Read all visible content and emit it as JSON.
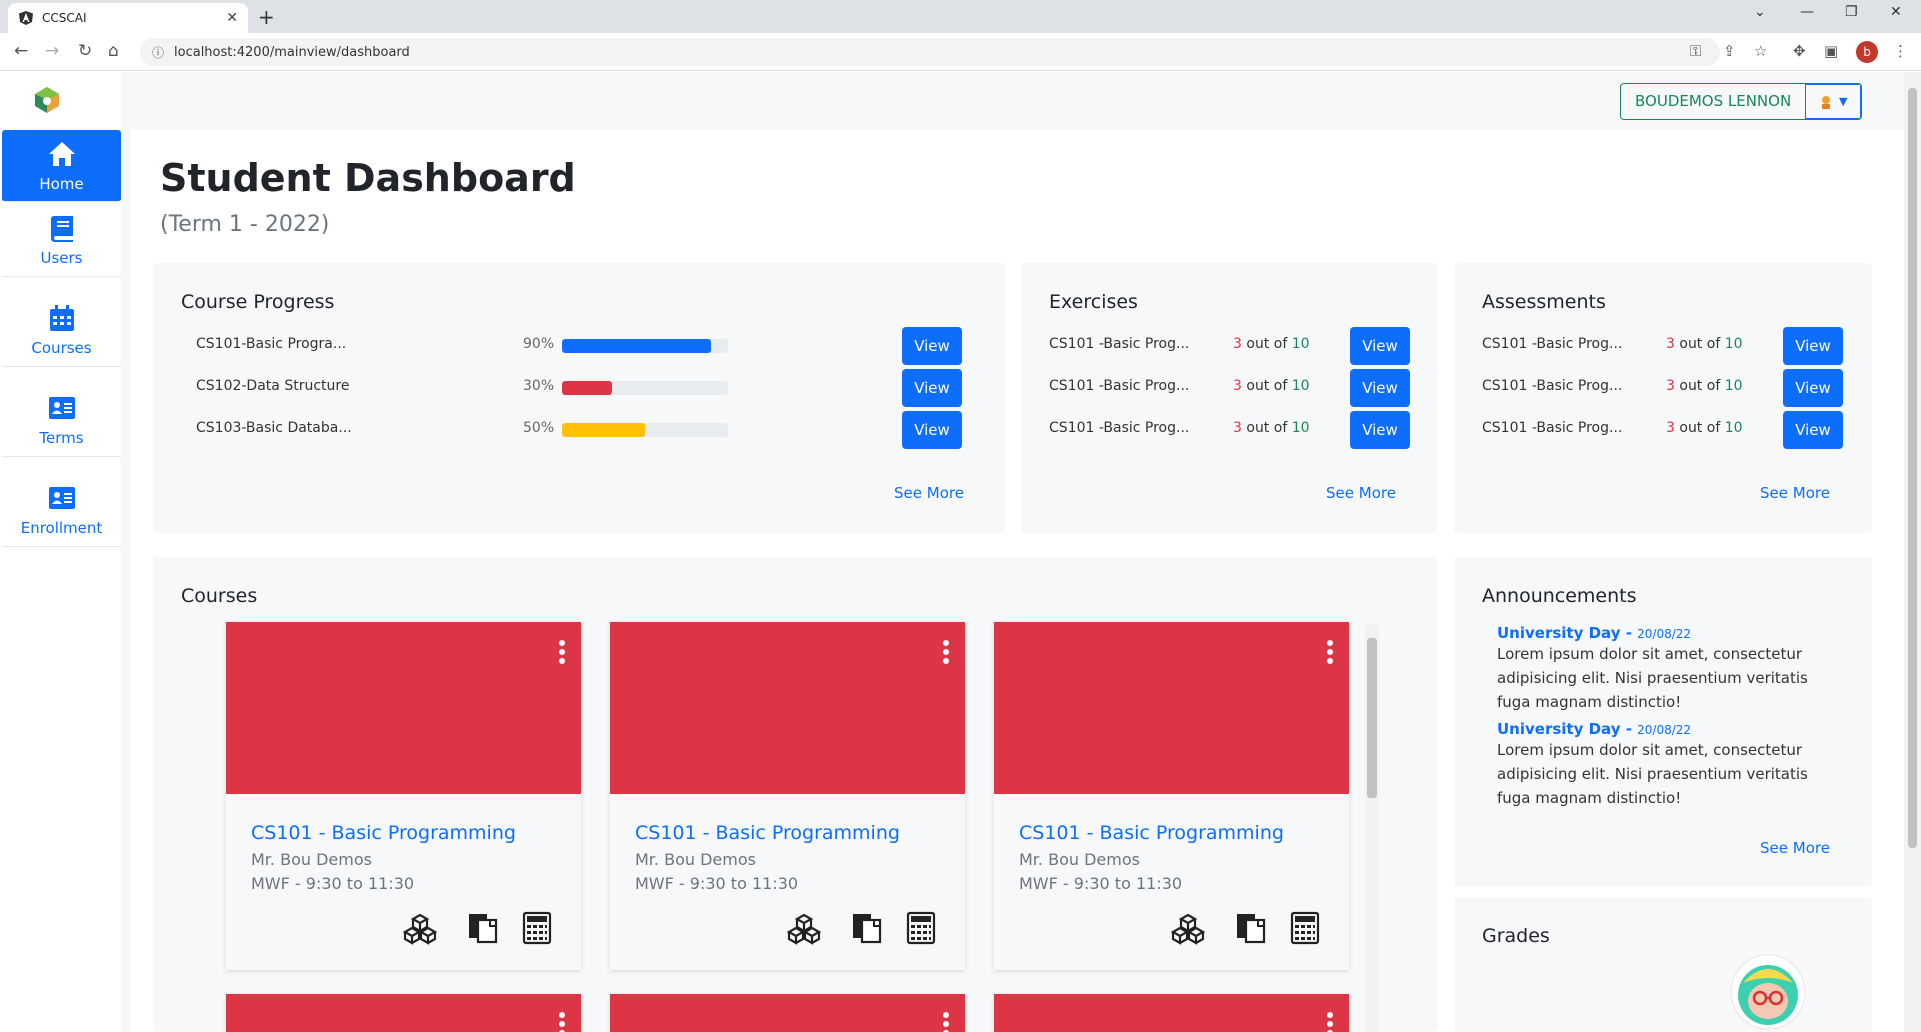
{
  "browser": {
    "tab_title": "CCSCAI",
    "url": "localhost:4200/mainview/dashboard",
    "profile_initial": "b"
  },
  "sidebar": {
    "items": [
      {
        "label": "Home",
        "icon": "home-icon",
        "active": true
      },
      {
        "label": "Users",
        "icon": "book-icon"
      },
      {
        "label": "Courses",
        "icon": "calendar-icon"
      },
      {
        "label": "Terms",
        "icon": "id-card-icon"
      },
      {
        "label": "Enrollment",
        "icon": "id-card-icon"
      }
    ]
  },
  "header": {
    "user_name": "BOUDEMOS LENNON"
  },
  "page": {
    "title": "Student Dashboard",
    "subtitle": "(Term 1 - 2022)"
  },
  "course_progress": {
    "title": "Course Progress",
    "rows": [
      {
        "name": "CS101-Basic Progra...",
        "pct": "90%",
        "value": 0.9,
        "color": "#0d6efd"
      },
      {
        "name": "CS102-Data Structure",
        "pct": "30%",
        "value": 0.3,
        "color": "#dc3545"
      },
      {
        "name": "CS103-Basic Databa...",
        "pct": "50%",
        "value": 0.5,
        "color": "#ffc107"
      }
    ],
    "view_label": "View",
    "see_more": "See More"
  },
  "exercises": {
    "title": "Exercises",
    "rows": [
      {
        "name": "CS101 -Basic Prog...",
        "done": "3",
        "mid": " out of ",
        "total": "10"
      },
      {
        "name": "CS101 -Basic Prog...",
        "done": "3",
        "mid": " out of ",
        "total": "10"
      },
      {
        "name": "CS101 -Basic Prog...",
        "done": "3",
        "mid": " out of ",
        "total": "10"
      }
    ],
    "view_label": "View",
    "see_more": "See More"
  },
  "assessments": {
    "title": "Assessments",
    "rows": [
      {
        "name": "CS101 -Basic Prog...",
        "done": "3",
        "mid": " out of ",
        "total": "10"
      },
      {
        "name": "CS101 -Basic Prog...",
        "done": "3",
        "mid": " out of ",
        "total": "10"
      },
      {
        "name": "CS101 -Basic Prog...",
        "done": "3",
        "mid": " out of ",
        "total": "10"
      }
    ],
    "view_label": "View",
    "see_more": "See More"
  },
  "courses": {
    "title": "Courses",
    "cards": [
      {
        "name": "CS101 - Basic Programming",
        "prof": "Mr. Bou Demos",
        "sched": "MWF - 9:30 to 11:30"
      },
      {
        "name": "CS101 - Basic Programming",
        "prof": "Mr. Bou Demos",
        "sched": "MWF - 9:30 to 11:30"
      },
      {
        "name": "CS101 - Basic Programming",
        "prof": "Mr. Bou Demos",
        "sched": "MWF - 9:30 to 11:30"
      }
    ],
    "banner_color": "#dc3545"
  },
  "announcements": {
    "title": "Announcements",
    "items": [
      {
        "title": "University Day - ",
        "date": "20/08/22",
        "body": "Lorem ipsum dolor sit amet, consectetur adipisicing elit. Nisi praesentium veritatis fuga magnam distinctio!"
      },
      {
        "title": "University Day - ",
        "date": "20/08/22",
        "body": "Lorem ipsum dolor sit amet, consectetur adipisicing elit. Nisi praesentium veritatis fuga magnam distinctio!"
      }
    ],
    "see_more": "See More"
  },
  "grades": {
    "title": "Grades"
  }
}
